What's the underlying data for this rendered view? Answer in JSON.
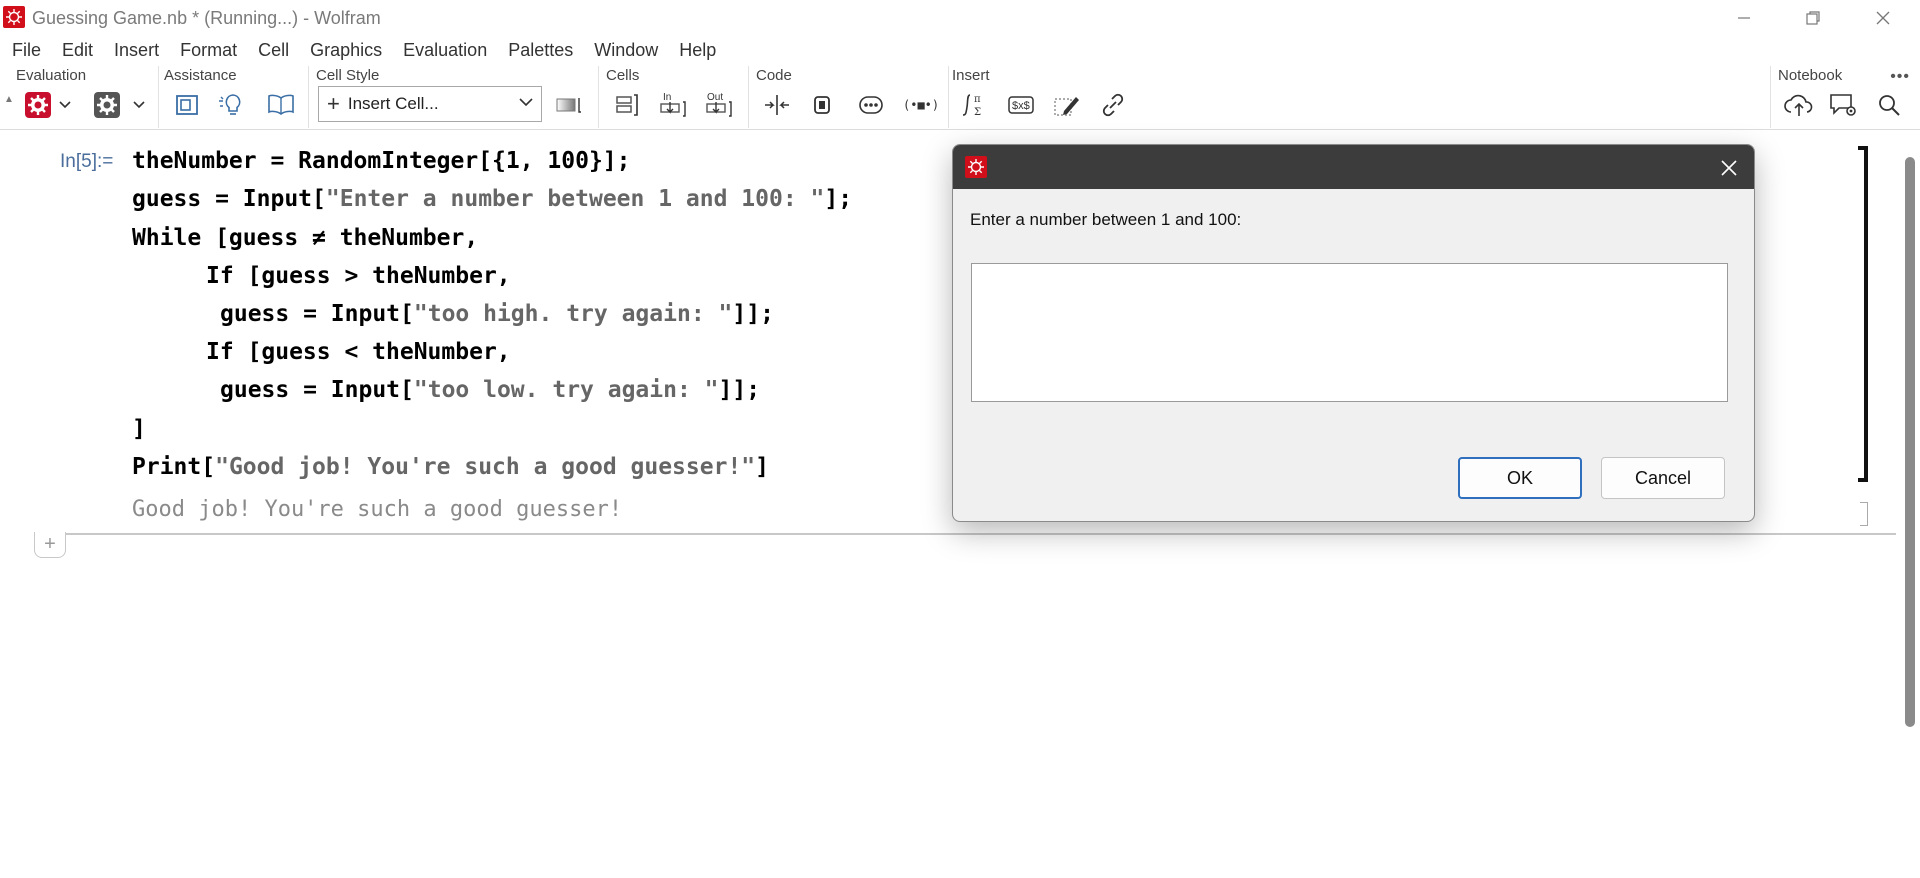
{
  "window": {
    "title": "Guessing Game.nb * (Running...) - Wolfram"
  },
  "menu": [
    "File",
    "Edit",
    "Insert",
    "Format",
    "Cell",
    "Graphics",
    "Evaluation",
    "Palettes",
    "Window",
    "Help"
  ],
  "toolbar": {
    "groups": {
      "evaluation": "Evaluation",
      "assistance": "Assistance",
      "cell_style": "Cell Style",
      "cells": "Cells",
      "code": "Code",
      "insert": "Insert",
      "notebook": "Notebook"
    },
    "cell_style_value": "Insert Cell...",
    "cells_in_label": "In",
    "cells_out_label": "Out",
    "more": "•••"
  },
  "notebook": {
    "cell_label": "In[5]:=",
    "code": {
      "l1": "theNumber = RandomInteger[{1, 100}];",
      "l2a": "guess = Input[",
      "l2b": "\"Enter a number between 1 and 100: \"",
      "l2c": "];",
      "l3": "While [guess ≠ theNumber,",
      "l4": "If [guess > theNumber,",
      "l5a": "guess = Input[",
      "l5b": "\"too high. try again: \"",
      "l5c": "]];",
      "l6": "If [guess < theNumber,",
      "l7a": "guess = Input[",
      "l7b": "\"too low. try again: \"",
      "l7c": "]];",
      "l8": "]",
      "l9a": "Print[",
      "l9b": "\"Good job! You're such a good guesser!\"",
      "l9c": "]"
    },
    "output": "Good job! You're such a good guesser!",
    "insert_plus": "+"
  },
  "dialog": {
    "prompt": "Enter a number between 1 and 100:",
    "input_value": "",
    "ok_label": "OK",
    "cancel_label": "Cancel"
  }
}
